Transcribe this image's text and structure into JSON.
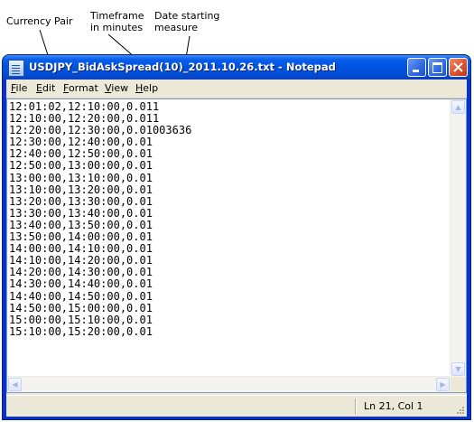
{
  "annotations": {
    "currency_pair": "Currency Pair",
    "timeframe": "Timeframe\nin minutes",
    "date_start": "Date starting\nmeasure"
  },
  "window": {
    "title": "USDJPY_BidAskSpread(10)_2011.10.26.txt - Notepad",
    "icon": "notepad-icon",
    "controls": [
      "minimize-icon",
      "maximize-icon",
      "close-icon"
    ]
  },
  "menu": {
    "file": {
      "u": "F",
      "rest": "ile"
    },
    "edit": {
      "u": "E",
      "rest": "dit"
    },
    "format": {
      "u": "F",
      "rest": "ormat"
    },
    "view": {
      "u": "V",
      "rest": "iew"
    },
    "help": {
      "u": "H",
      "rest": "elp"
    }
  },
  "document": {
    "lines": [
      "12:01:02,12:10:00,0.011",
      "12:10:00,12:20:00,0.011",
      "12:20:00,12:30:00,0.01003636",
      "12:30:00,12:40:00,0.01",
      "12:40:00,12:50:00,0.01",
      "12:50:00,13:00:00,0.01",
      "13:00:00,13:10:00,0.01",
      "13:10:00,13:20:00,0.01",
      "13:20:00,13:30:00,0.01",
      "13:30:00,13:40:00,0.01",
      "13:40:00,13:50:00,0.01",
      "13:50:00,14:00:00,0.01",
      "14:00:00,14:10:00,0.01",
      "14:10:00,14:20:00,0.01",
      "14:20:00,14:30:00,0.01",
      "14:30:00,14:40:00,0.01",
      "14:40:00,14:50:00,0.01",
      "14:50:00,15:00:00,0.01",
      "15:00:00,15:10:00,0.01",
      "15:10:00,15:20:00,0.01"
    ]
  },
  "status": {
    "position": "Ln 21, Col 1"
  },
  "colors": {
    "titlebar": "#0054e3",
    "chrome": "#ece9d8",
    "close_button": "#d8502b"
  }
}
